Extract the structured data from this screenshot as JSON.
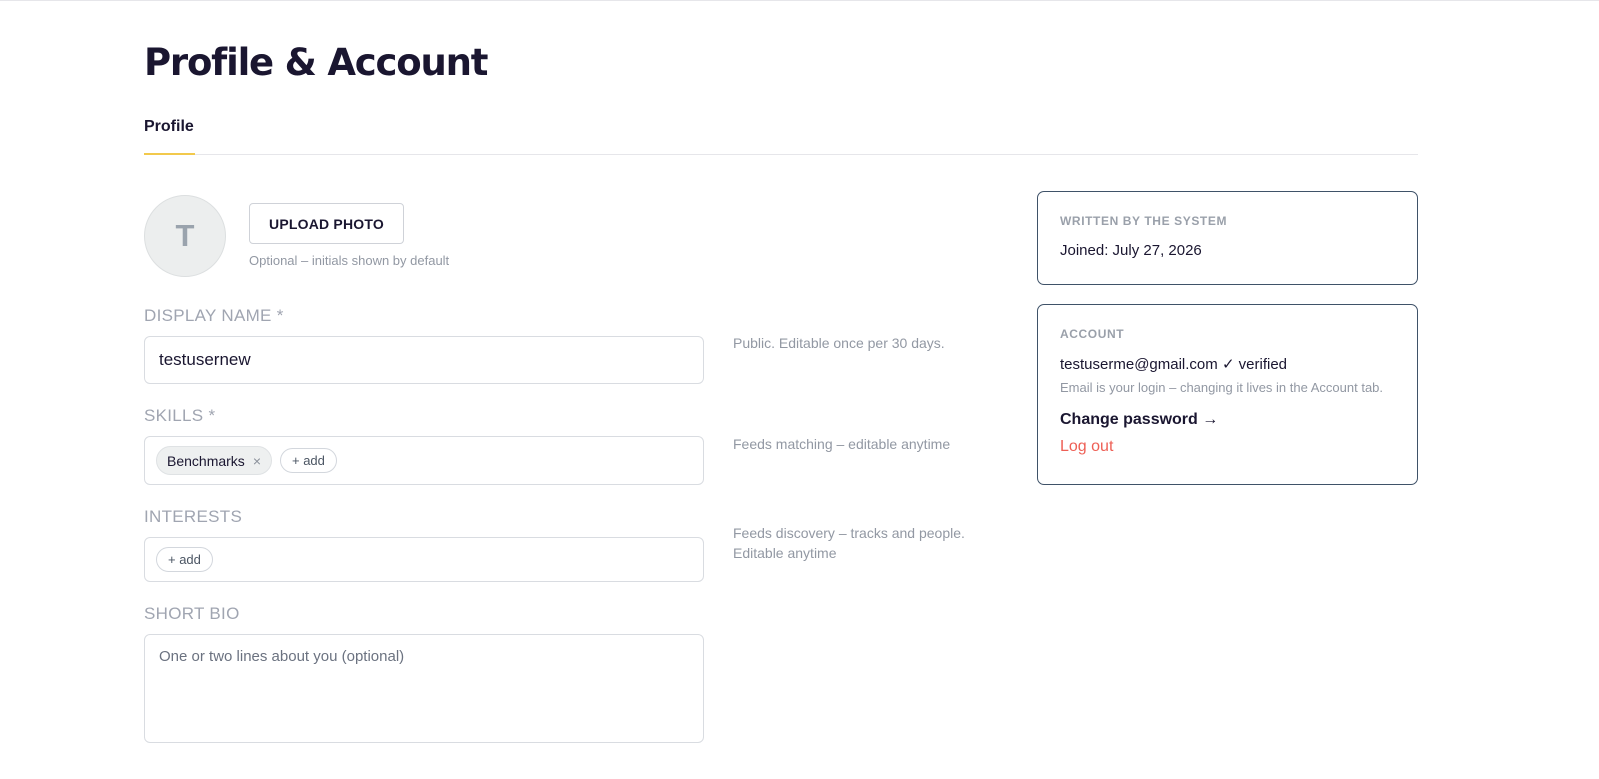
{
  "page": {
    "title": "Profile & Account"
  },
  "tabs": [
    {
      "label": "Profile",
      "active": true
    }
  ],
  "profile": {
    "avatar_initial": "T",
    "upload_label": "UPLOAD PHOTO",
    "upload_hint": "Optional – initials shown by default",
    "display_name": {
      "label": "DISPLAY NAME *",
      "value": "testusernew",
      "hint": "Public. Editable once per 30 days."
    },
    "skills": {
      "label": "SKILLS *",
      "chips": [
        "Benchmarks"
      ],
      "add_label": "+ add",
      "remove_glyph": "×",
      "hint": "Feeds matching – editable anytime"
    },
    "interests": {
      "label": "INTERESTS",
      "chips": [],
      "add_label": "+ add",
      "hint": "Feeds discovery – tracks and people. Editable anytime"
    },
    "bio": {
      "label": "SHORT BIO",
      "value": "",
      "placeholder": "One or two lines about you (optional)"
    }
  },
  "system_card": {
    "heading": "WRITTEN BY THE SYSTEM",
    "joined": "Joined: July 27, 2026"
  },
  "account_card": {
    "heading": "ACCOUNT",
    "email": "testuserme@gmail.com ✓ verified",
    "email_note": "Email is your login – changing it lives in the Account tab.",
    "change_password": "Change password →",
    "logout": "Log out"
  },
  "colors": {
    "text": "#1a1630",
    "muted": "#9298a3",
    "accent_tab": "#f2c94c",
    "card_border": "#3f5268",
    "danger": "#ee5f55"
  }
}
